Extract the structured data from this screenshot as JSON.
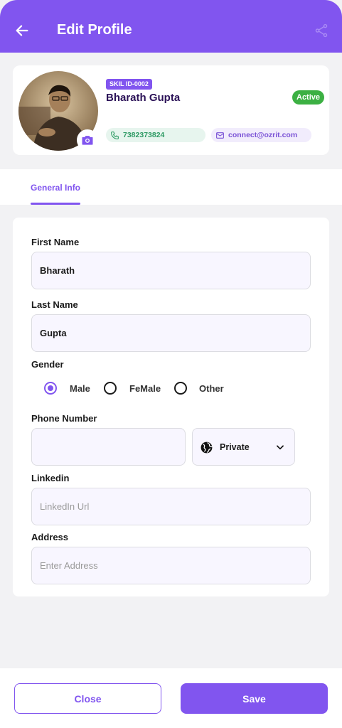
{
  "header": {
    "title": "Edit Profile",
    "back_icon": "arrow-left-icon",
    "share_icon": "share-icon",
    "bg_color": "#8155ef"
  },
  "profile": {
    "skil_id": "SKIL ID-0002",
    "name": "Bharath Gupta",
    "status": "Active",
    "phone": "7382373824",
    "email": "connect@ozrit.com",
    "camera_icon": "camera-icon"
  },
  "tabs": [
    {
      "label": "General Info",
      "active": true
    }
  ],
  "form": {
    "first_name": {
      "label": "First Name",
      "value": "Bharath"
    },
    "last_name": {
      "label": "Last Name",
      "value": "Gupta"
    },
    "gender": {
      "label": "Gender",
      "options": [
        "Male",
        "FeMale",
        "Other"
      ],
      "selected": "Male"
    },
    "phone": {
      "label": "Phone Number",
      "value": "",
      "privacy": "Private",
      "privacy_icon": "globe-icon"
    },
    "linkedin": {
      "label": "Linkedin",
      "placeholder": "LinkedIn Url"
    },
    "address": {
      "label": "Address",
      "placeholder": "Enter Address"
    }
  },
  "footer": {
    "close_label": "Close",
    "save_label": "Save"
  },
  "colors": {
    "accent": "#8155ef",
    "active_badge": "#3cb043",
    "phone_pill_text": "#2e9a64",
    "email_pill_text": "#7a52d6"
  }
}
